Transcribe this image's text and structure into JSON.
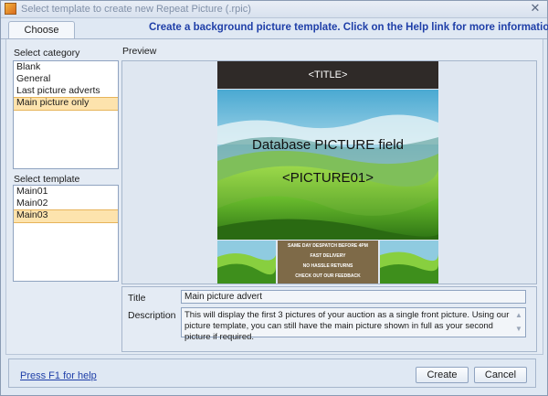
{
  "window": {
    "title": "Select template to create new Repeat Picture (.rpic)",
    "close_glyph": "✕"
  },
  "tabs": [
    {
      "label": "Choose template"
    }
  ],
  "info_text": "Create a background picture template.  Click on the Help link for more information.",
  "category": {
    "label": "Select category",
    "items": [
      "Blank",
      "General",
      "Last picture adverts",
      "Main picture only"
    ],
    "selected": "Main picture only"
  },
  "template": {
    "label": "Select template",
    "items": [
      "Main01",
      "Main02",
      "Main03"
    ],
    "selected": "Main03"
  },
  "preview": {
    "label": "Preview",
    "header_text": "<TITLE>",
    "main_text_1": "Database PICTURE field",
    "main_text_2": "<PICTURE01>",
    "badges": [
      "SAME DAY DESPATCH BEFORE 4PM",
      "FAST DELIVERY",
      "NO HASSLE RETURNS",
      "CHECK OUT OUR FEEDBACK"
    ],
    "colors": {
      "header_bg": "#2f2a28",
      "badge_bg": "#7e6a48",
      "sky": "#5fb8d6",
      "hill_light": "#8fd33b",
      "hill_dark": "#3e8f1c"
    }
  },
  "details": {
    "title_label": "Title",
    "title_value": "Main picture advert",
    "description_label": "Description",
    "description_value": "This will display the first 3 pictures of your auction as a single front picture.   Using our picture template, you can still have the main picture shown in full as your second picture if required."
  },
  "footer": {
    "help_link": "Press F1 for help",
    "create_label": "Create",
    "cancel_label": "Cancel"
  },
  "icons": {
    "app": "picture-app-icon",
    "close": "close-icon",
    "scroll_up": "chevron-up-icon",
    "scroll_down": "chevron-down-icon"
  }
}
